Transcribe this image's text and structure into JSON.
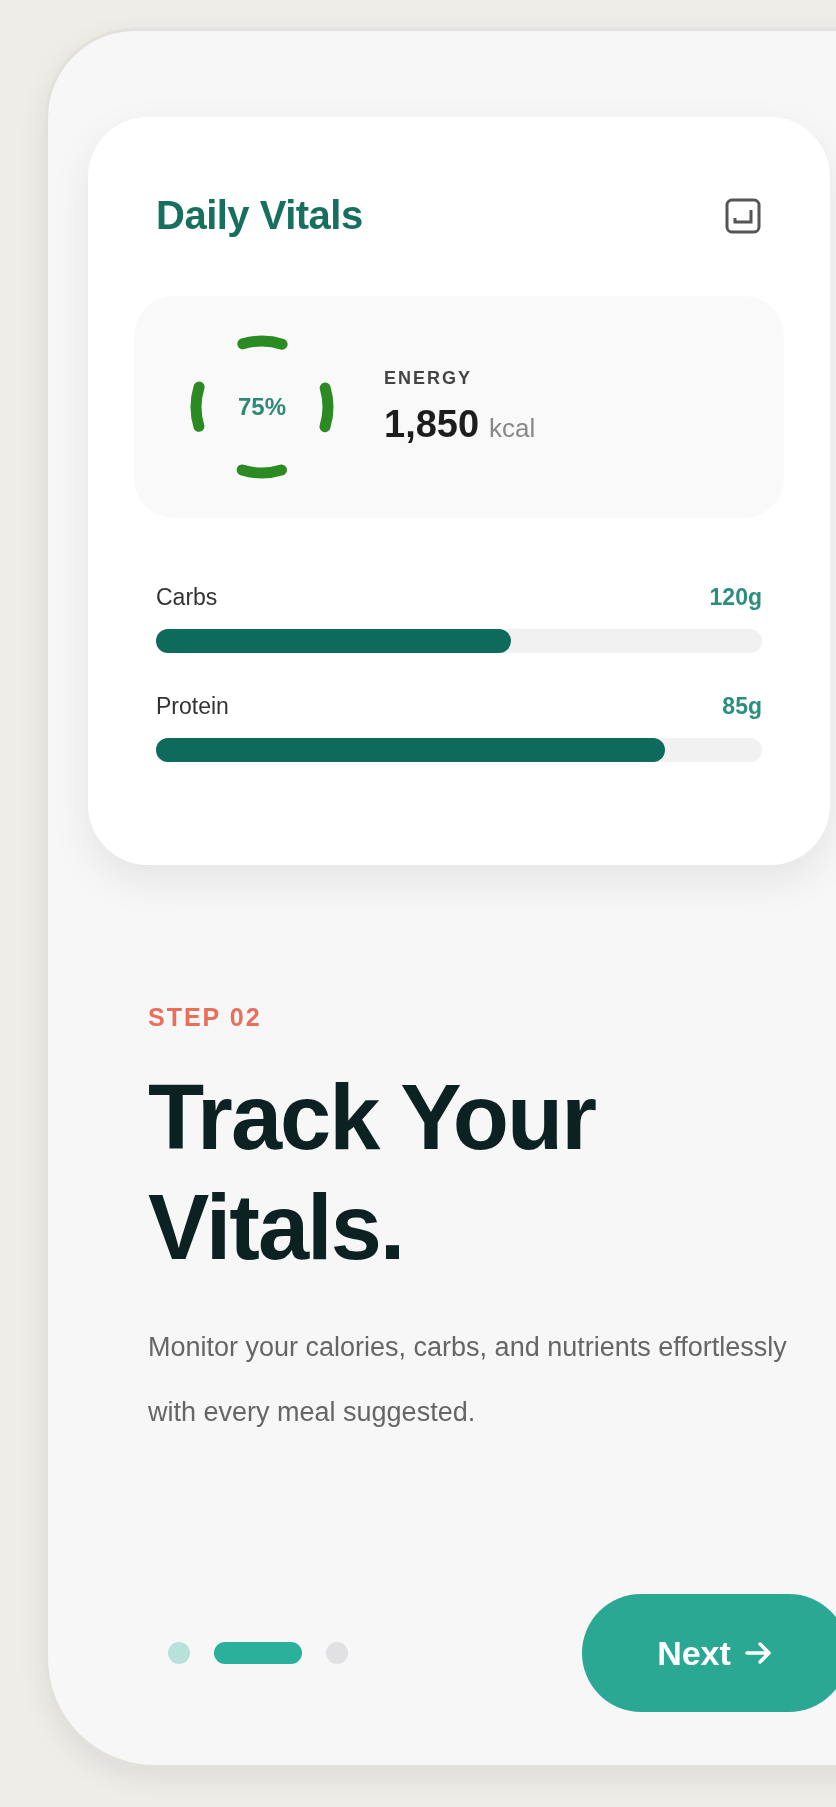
{
  "card": {
    "title": "Daily Vitals",
    "energy": {
      "percent": "75%",
      "label": "ENERGY",
      "value": "1,850",
      "unit": "kcal"
    },
    "nutrients": [
      {
        "name": "Carbs",
        "amount": "120g",
        "level": 0.585
      },
      {
        "name": "Protein",
        "amount": "85g",
        "level": 0.84
      }
    ]
  },
  "step": "STEP 02",
  "headline": "Track Your Vitals.",
  "description": "Monitor your calories, carbs, and nutrients effortlessly with every meal suggested.",
  "pager": [
    {
      "selected": false,
      "done": true
    },
    {
      "selected": true,
      "done": false
    },
    {
      "selected": false,
      "done": false
    }
  ],
  "next_button": "Next"
}
